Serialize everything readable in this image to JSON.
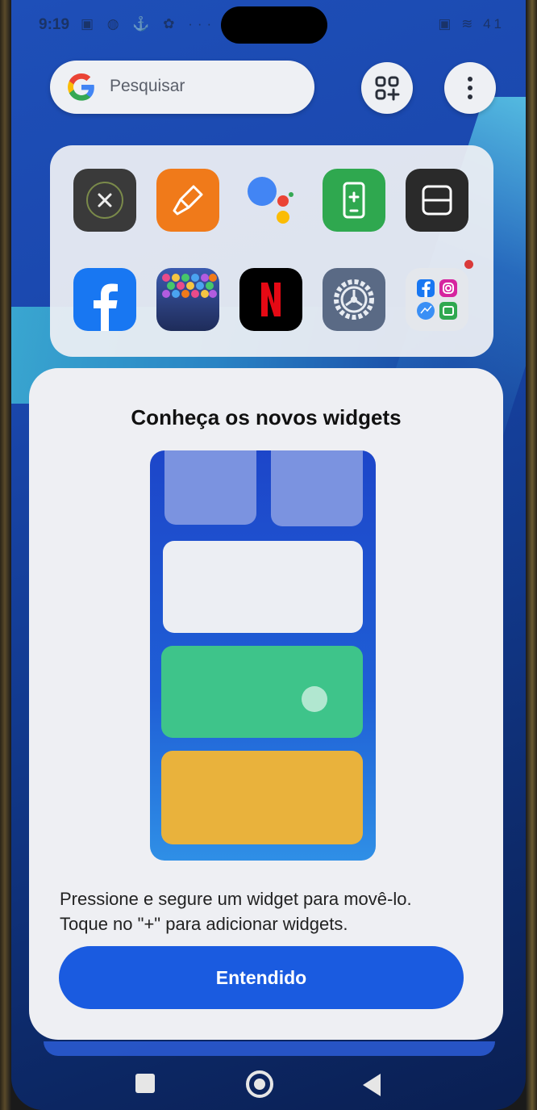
{
  "status_bar": {
    "time": "9:19",
    "left_icons": "▣ ◍ ⚓ ✿ ···",
    "right_icons": "▣ ≋ 41"
  },
  "search": {
    "placeholder": "Pesquisar"
  },
  "apps": [
    {
      "icon": "close-circle-icon",
      "bg": "#3a3a3a"
    },
    {
      "icon": "paint-brush-icon",
      "bg": "#f07a1a"
    },
    {
      "icon": "google-assistant-icon",
      "bg": "transparent"
    },
    {
      "icon": "phone-clone-icon",
      "bg": "#2fa84f"
    },
    {
      "icon": "scanner-icon",
      "bg": "#2a2a2a"
    },
    {
      "icon": "facebook-icon",
      "bg": "#1877f2"
    },
    {
      "icon": "bubble-game-icon",
      "bg": "#2b3e7a"
    },
    {
      "icon": "netflix-icon",
      "bg": "#000000"
    },
    {
      "icon": "settings-icon",
      "bg": "#5a6a85"
    },
    {
      "icon": "folder-social-icon",
      "bg": "#e4e7ec"
    }
  ],
  "dialog": {
    "title": "Conheça os novos widgets",
    "desc_line1": "Pressione e segure um widget para movê-lo.",
    "desc_line2": "Toque no \"+\" para adicionar widgets.",
    "button": "Entendido"
  },
  "colors": {
    "accent": "#1a5be0",
    "card_green": "#3ec48a",
    "card_yellow": "#e9b23c",
    "card_lavender": "#7b93e0"
  }
}
